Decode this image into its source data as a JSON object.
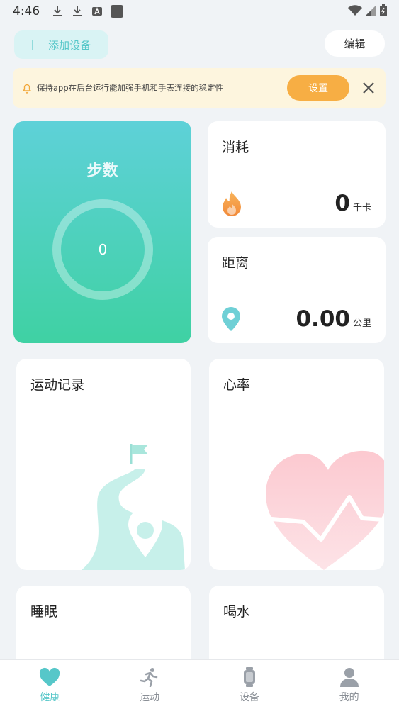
{
  "status_bar": {
    "time": "4:46"
  },
  "header": {
    "add_device_label": "添加设备",
    "edit_label": "编辑"
  },
  "notice": {
    "text": "保持app在后台运行能加强手机和手表连接的稳定性",
    "button_label": "设置"
  },
  "steps": {
    "title": "步数",
    "value": "0"
  },
  "consumption": {
    "title": "消耗",
    "value": "0",
    "unit": "千卡"
  },
  "distance": {
    "title": "距离",
    "value": "0.00",
    "unit": "公里"
  },
  "cards": {
    "exercise_record": "运动记录",
    "heart_rate": "心率",
    "sleep": "睡眠",
    "drink_water": "喝水"
  },
  "nav": {
    "items": [
      {
        "label": "健康",
        "icon": "heart-icon"
      },
      {
        "label": "运动",
        "icon": "running-icon"
      },
      {
        "label": "设备",
        "icon": "watch-icon"
      },
      {
        "label": "我的",
        "icon": "person-icon"
      }
    ]
  },
  "colors": {
    "accent": "#56c7c9",
    "orange": "#f7ae44",
    "heart": "#fcd3d9"
  }
}
